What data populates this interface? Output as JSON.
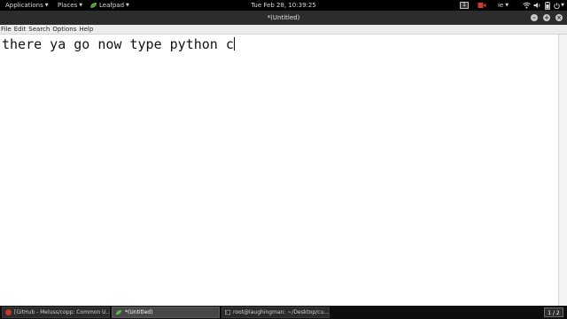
{
  "panel": {
    "menus": [
      {
        "label": "Applications"
      },
      {
        "label": "Places"
      },
      {
        "label": "Leafpad"
      }
    ],
    "clock": "Tue Feb 28, 10:39:25",
    "workspace_badge": "1",
    "keyboard_layout": "ie",
    "colors": {
      "background": "#000000",
      "text": "#d8d8d8",
      "leaf_icon": "#5fb34a",
      "tray_red": "#d23a2f"
    }
  },
  "window": {
    "title": "*(Untitled)",
    "controls": {
      "minimize": "–",
      "maximize": "+",
      "close": "×"
    }
  },
  "menubar": {
    "items": [
      "File",
      "Edit",
      "Search",
      "Options",
      "Help"
    ]
  },
  "editor": {
    "text": "there ya go now type python c"
  },
  "taskbar": {
    "tasks": [
      {
        "label": "[GitHub - Meluss/copp: Common U...",
        "icon": "browser-icon",
        "color": "#c0392b"
      },
      {
        "label": "*(Untitled)",
        "icon": "leafpad-icon",
        "color": "#5fb34a"
      },
      {
        "label": "root@laughingman: ~/Desktop/cu...",
        "icon": "terminal-icon",
        "color": "#bdbdbd"
      }
    ],
    "pager": "1 / 2"
  }
}
